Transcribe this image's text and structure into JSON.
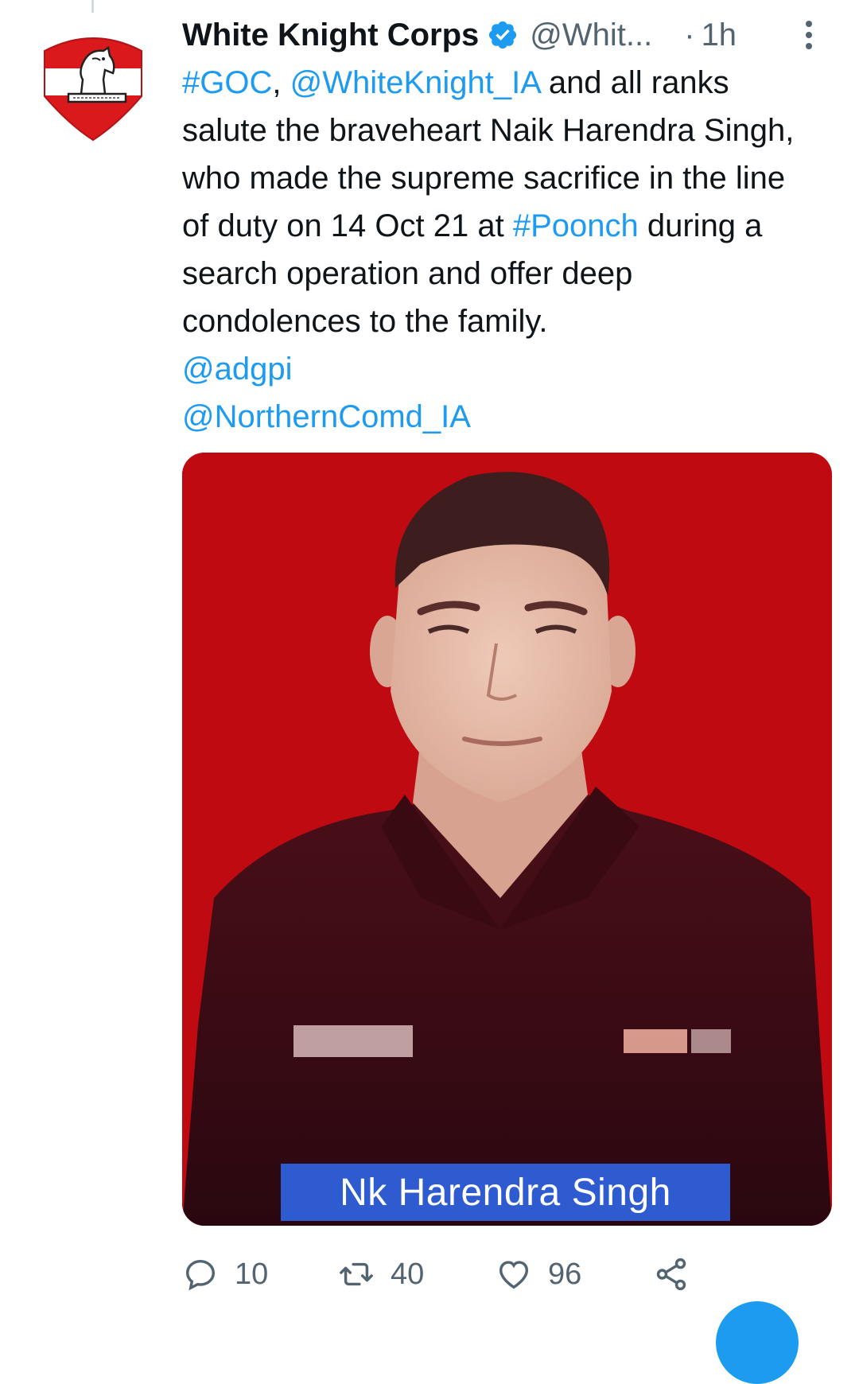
{
  "tweet": {
    "author_name": "White Knight Corps",
    "handle": "@Whit...",
    "separator": "·",
    "time": "1h",
    "text_segments": [
      {
        "text": "#GOC",
        "link": true
      },
      {
        "text": ", ",
        "link": false
      },
      {
        "text": "@WhiteKnight_IA",
        "link": true
      },
      {
        "text": " and all ranks salute the braveheart Naik Harendra Singh, who made the supreme sacrifice in the line of duty on 14 Oct 21 at ",
        "link": false
      },
      {
        "text": "#Poonch",
        "link": true
      },
      {
        "text": " during a search operation and offer deep condolences to the family.",
        "link": false
      },
      {
        "text": "@adgpi",
        "link": true,
        "block": true
      },
      {
        "text": "@NorthernComd_IA",
        "link": true,
        "block": true
      }
    ],
    "image_caption": "Nk Harendra Singh",
    "actions": {
      "replies": "10",
      "retweets": "40",
      "likes": "96"
    }
  },
  "icons": {
    "verified": "verified-badge-icon",
    "more": "more-vertical-icon",
    "reply": "reply-icon",
    "retweet": "retweet-icon",
    "like": "heart-icon",
    "share": "share-icon"
  },
  "colors": {
    "link": "#1d9bf0",
    "secondary_text": "#536471",
    "primary_text": "#0f1419",
    "media_background": "#c00a12",
    "caption_box": "#2f5bd0"
  }
}
